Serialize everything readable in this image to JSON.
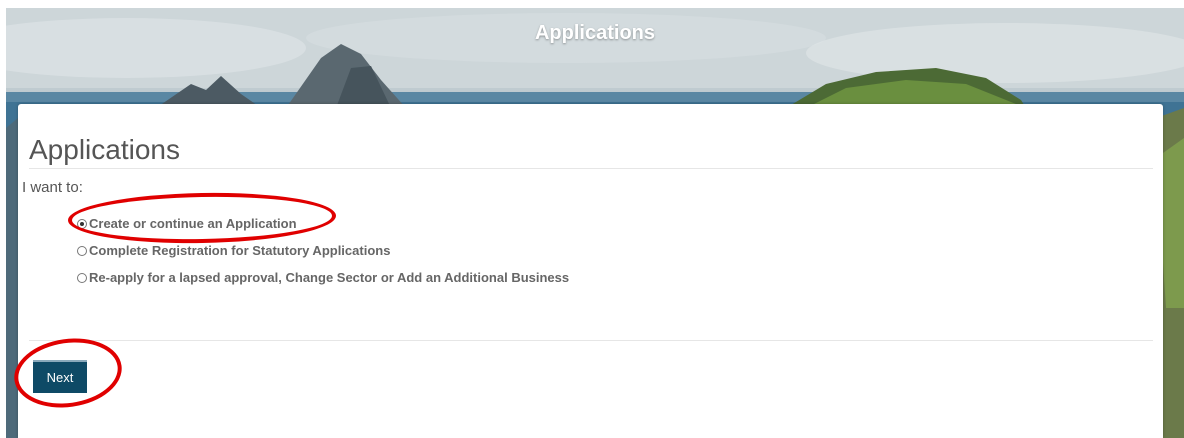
{
  "banner": {
    "title": "Applications"
  },
  "panel": {
    "heading": "Applications",
    "prompt": "I want to:",
    "options": [
      {
        "label": "Create or continue an Application",
        "checked": true
      },
      {
        "label": "Complete Registration for Statutory Applications",
        "checked": false
      },
      {
        "label": "Re-apply for a lapsed approval, Change Sector or Add an Additional Business",
        "checked": false
      }
    ],
    "next_label": "Next"
  },
  "colors": {
    "button_bg": "#0e4a66",
    "annotation": "#e00000",
    "text": "#555555"
  }
}
